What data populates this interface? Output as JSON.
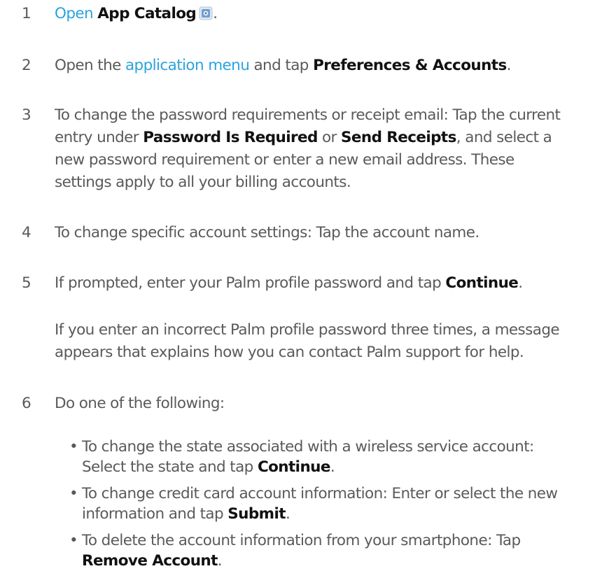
{
  "steps": [
    {
      "num": "1",
      "link": "Open",
      "bold": "App Catalog",
      "icon": "app-catalog-icon",
      "end": "."
    },
    {
      "num": "2",
      "pre": "Open the ",
      "link": "application menu",
      "mid": " and tap ",
      "bold": "Preferences & Accounts",
      "end": "."
    },
    {
      "num": "3",
      "line1": "To change the password requirements or receipt email: Tap the current",
      "line2_pre": "entry under ",
      "bold1": "Password Is Required",
      "or": " or ",
      "bold2": "Send Receipts",
      "line2_post": ", and select a",
      "line3": "new password requirement or enter a new email address. These",
      "line4": "settings apply to all your billing accounts."
    },
    {
      "num": "4",
      "text": "To change specific account settings: Tap the account name."
    },
    {
      "num": "5",
      "pre": "If prompted, enter your Palm profile password and tap ",
      "bold": "Continue",
      "end": "."
    },
    {
      "num": "",
      "line1": "If you enter an incorrect Palm profile password three times, a message",
      "line2": "appears that explains how you can contact Palm support for help."
    },
    {
      "num": "6",
      "text": "Do one of the following:"
    }
  ],
  "bullets": [
    {
      "line1": "To change the state associated with a wireless service account:",
      "line2_pre": "Select the state and tap ",
      "bold": "Continue",
      "end": "."
    },
    {
      "line1": "To change credit card account information: Enter or select the new",
      "line2_pre": "information and tap ",
      "bold": "Submit",
      "end": "."
    },
    {
      "line1": "To delete the account information from your smartphone: Tap",
      "bold": "Remove Account",
      "end": "."
    }
  ],
  "bullet_char": "•",
  "colors": {
    "text": "#5a5a5a",
    "bold": "#111111",
    "link": "#2aa3dd"
  }
}
